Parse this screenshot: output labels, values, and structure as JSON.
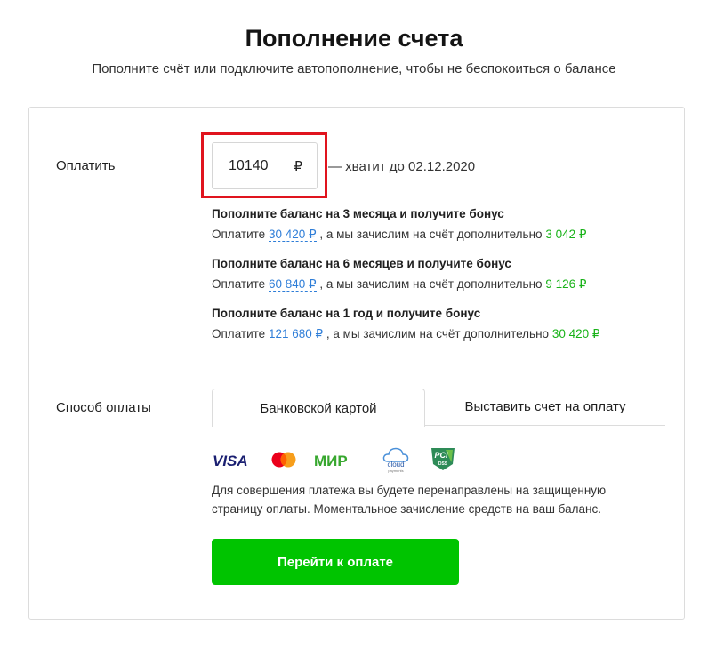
{
  "header": {
    "title": "Пополнение счета",
    "subtitle": "Пополните счёт или подключите автопополнение, чтобы не беспокоиться о балансе"
  },
  "payment": {
    "label": "Оплатить",
    "amount": "10140",
    "currency": "₽",
    "enough_until": "— хватит до 02.12.2020"
  },
  "bonuses": [
    {
      "title": "Пополните баланс на 3 месяца и получите бонус",
      "prefix": "Оплатите",
      "pay_amount": "30 420 ₽",
      "middle": ", а мы зачислим на счёт дополнительно",
      "bonus_amount": "3 042 ₽"
    },
    {
      "title": "Пополните баланс на 6 месяцев и получите бонус",
      "prefix": "Оплатите",
      "pay_amount": "60 840 ₽",
      "middle": ", а мы зачислим на счёт дополнительно",
      "bonus_amount": "9 126 ₽"
    },
    {
      "title": "Пополните баланс на 1 год и получите бонус",
      "prefix": "Оплатите",
      "pay_amount": "121 680 ₽",
      "middle": ", а мы зачислим на счёт дополнительно",
      "bonus_amount": "30 420 ₽"
    }
  ],
  "method": {
    "label": "Способ оплаты",
    "tabs": [
      "Банковской картой",
      "Выставить счет на оплату"
    ],
    "active_tab": "Банковской картой",
    "logos": {
      "visa": "VISA",
      "mir": "МИР",
      "cloud": "cloud",
      "cloud_sub": "payments",
      "pci": "PCI",
      "dss": "DSS"
    },
    "notice": "Для совершения платежа вы будете перенаправлены на защищенную страницу оплаты. Моментальное зачисление средств на ваш баланс.",
    "button": "Перейти к оплате"
  },
  "colors": {
    "accent_green": "#00c400",
    "bonus_green": "#18b218",
    "link_blue": "#2f7ed8",
    "highlight_red": "#e0141e"
  }
}
